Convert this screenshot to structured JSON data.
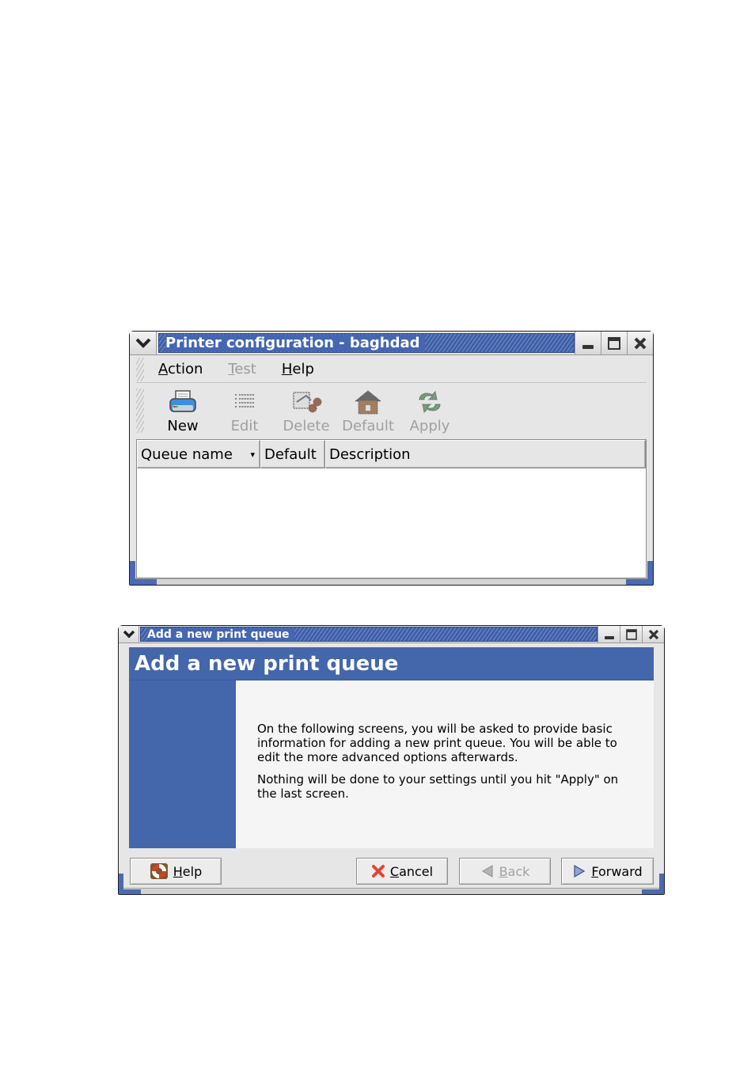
{
  "printer_config_window": {
    "title": "Printer configuration - baghdad",
    "menu": [
      {
        "label": "Action",
        "mnemonic": "A",
        "rest": "ction",
        "enabled": true
      },
      {
        "label": "Test",
        "mnemonic": "T",
        "rest": "est",
        "enabled": false
      },
      {
        "label": "Help",
        "mnemonic": "H",
        "rest": "elp",
        "enabled": true
      }
    ],
    "toolbar": [
      {
        "label": "New",
        "icon": "printer-icon",
        "enabled": true
      },
      {
        "label": "Edit",
        "icon": "list-icon",
        "enabled": false
      },
      {
        "label": "Delete",
        "icon": "scissors-icon",
        "enabled": false
      },
      {
        "label": "Default",
        "icon": "home-icon",
        "enabled": false
      },
      {
        "label": "Apply",
        "icon": "refresh-icon",
        "enabled": false
      }
    ],
    "columns": [
      "Queue name",
      "Default",
      "Description"
    ],
    "sort_indicator": "▾",
    "rows": []
  },
  "add_queue_window": {
    "title": "Add a new print queue",
    "banner": "Add a new print queue",
    "paragraphs": [
      "On the following screens, you will be asked to provide basic information for adding a new print queue.  You will be able to edit the more advanced options afterwards.",
      "Nothing will be done to your settings until you hit \"Apply\" on the last screen."
    ],
    "buttons": {
      "help": {
        "mnemonic": "H",
        "rest": "elp",
        "icon": "lifebuoy-icon",
        "enabled": true
      },
      "cancel": {
        "mnemonic": "C",
        "rest": "ancel",
        "icon": "x-icon",
        "enabled": true
      },
      "back": {
        "mnemonic": "B",
        "rest": "ack",
        "icon": "left-arrow-icon",
        "enabled": false
      },
      "forward": {
        "mnemonic": "F",
        "rest": "orward",
        "icon": "right-arrow-icon",
        "enabled": true
      }
    }
  },
  "colors": {
    "titlebar_blue": "#3f5fa8",
    "banner_blue": "#4466ab",
    "window_bg": "#e6e6e6",
    "disabled_text": "#9c9c9c"
  }
}
